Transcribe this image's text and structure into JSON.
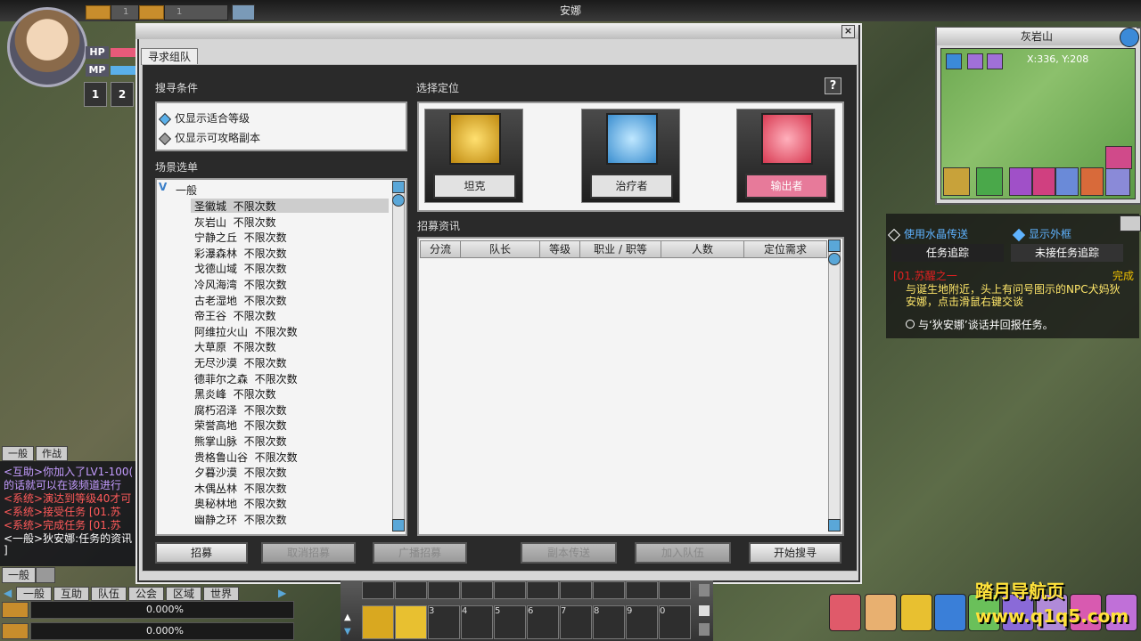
{
  "topbar": {
    "location": "安娜",
    "slot1": "1",
    "slot2": "1"
  },
  "player": {
    "hp_label": "HP",
    "mp_label": "MP",
    "skill1": "1",
    "skill2": "2"
  },
  "dialog": {
    "close": "×",
    "tab": "寻求组队",
    "search_conditions_label": "搜寻条件",
    "conditions": [
      "仅显示适合等级",
      "仅显示可攻略副本"
    ],
    "role_label": "选择定位",
    "help": "?",
    "roles": [
      {
        "label": "坦克",
        "color": "#d9a820"
      },
      {
        "label": "治疗者",
        "color": "#58a9e0"
      },
      {
        "label": "输出者",
        "color": "#e0506a"
      }
    ],
    "scene_menu_label": "场景选单",
    "scene_group": "一般",
    "scenes": [
      "圣徽城  不限次数",
      "灰岩山  不限次数",
      "宁静之丘  不限次数",
      "彩瀑森林  不限次数",
      "戈德山域  不限次数",
      "冷风海湾  不限次数",
      "古老湿地  不限次数",
      "帝王谷  不限次数",
      "阿维拉火山  不限次数",
      "大草原  不限次数",
      "无尽沙漠  不限次数",
      "德菲尔之森  不限次数",
      "黑炎峰  不限次数",
      "腐朽沼泽  不限次数",
      "荣誉高地  不限次数",
      "熊掌山脉  不限次数",
      "贵格鲁山谷  不限次数",
      "夕暮沙漠  不限次数",
      "木偶丛林  不限次数",
      "奥秘林地  不限次数",
      "幽静之环  不限次数"
    ],
    "recruit_info_label": "招募资讯",
    "columns": [
      "分流",
      "队长",
      "等级",
      "职业 / 职等",
      "人数",
      "定位需求"
    ],
    "buttons": [
      "招募",
      "取消招募",
      "广播招募",
      "副本传送",
      "加入队伍",
      "开始搜寻"
    ]
  },
  "minimap": {
    "title": "灰岩山",
    "coords": "X:336, Y:208"
  },
  "quest_tracker": {
    "opt1": "使用水晶传送",
    "opt2": "显示外框",
    "tab1": "任务追踪",
    "tab2": "未接任务追踪",
    "quest_title": "[01.苏醒之一",
    "status": "完成",
    "desc": "与诞生地附近，头上有问号图示的NPC犬妈狄安娜，点击滑鼠右键交谈",
    "task": "与‘狄安娜’谈话并回报任务。"
  },
  "chat": {
    "tabs": [
      "一般",
      "作战"
    ],
    "lines": [
      {
        "text": "<互助>你加入了LV1-100(",
        "color": "#c49cff"
      },
      {
        "text": "的话就可以在该频道进行",
        "color": "#c49cff"
      },
      {
        "text": "<系统>演达到等级40才可",
        "color": "#ff5a5a"
      },
      {
        "text": "<系统>接受任务 [01.苏",
        "color": "#ff5a5a"
      },
      {
        "text": "<系统>完成任务 [01.苏",
        "color": "#ff5a5a"
      },
      {
        "text": "<一般>狄安娜:任务的资讯",
        "color": "#ffffff"
      },
      {
        "text": "]",
        "color": "#ffffff"
      }
    ],
    "input_channel": "一般",
    "channels": [
      "一般",
      "互助",
      "队伍",
      "公会",
      "区域",
      "世界"
    ]
  },
  "exp": {
    "exp1": "0.000%",
    "exp2": "0.000%"
  },
  "actionbar": {
    "row2_nums": [
      "3",
      "4",
      "5",
      "6",
      "7",
      "8",
      "9",
      "0"
    ]
  },
  "branding": {
    "line1": "踏月导航页",
    "line2": "www.q1q5.com"
  }
}
